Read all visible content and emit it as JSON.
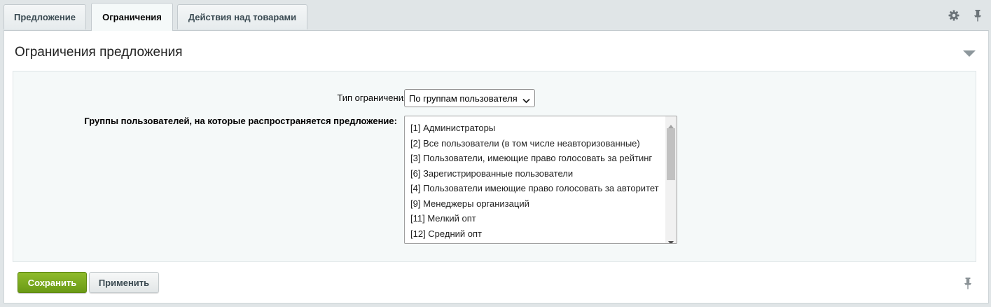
{
  "tabs": [
    {
      "label": "Предложение",
      "active": false
    },
    {
      "label": "Ограничения",
      "active": true
    },
    {
      "label": "Действия над товарами",
      "active": false
    }
  ],
  "toolbar": {
    "settings_icon": "gear-icon",
    "pin_icon": "pin-icon"
  },
  "section": {
    "title": "Ограничения предложения",
    "collapse_icon": "triangle-down-icon"
  },
  "form": {
    "restriction_type": {
      "label": "Тип ограничения",
      "value": "По группам пользователя"
    },
    "user_groups": {
      "label": "Группы пользователей, на которые распространяется предложение:",
      "options": [
        "[1] Администраторы",
        "[2] Все пользователи (в том числе неавторизованные)",
        "[3] Пользователи, имеющие право голосовать за рейтинг",
        "[6] Зарегистрированные пользователи",
        "[4] Пользователи имеющие право голосовать за авторитет",
        "[9] Менеджеры организаций",
        "[11] Мелкий опт",
        "[12] Средний опт"
      ]
    }
  },
  "actions": {
    "save_label": "Сохранить",
    "apply_label": "Применить"
  },
  "colors": {
    "save_button": "#7ba820",
    "panel_bg": "#f5f9f9",
    "page_bg": "#e0e5e7"
  }
}
